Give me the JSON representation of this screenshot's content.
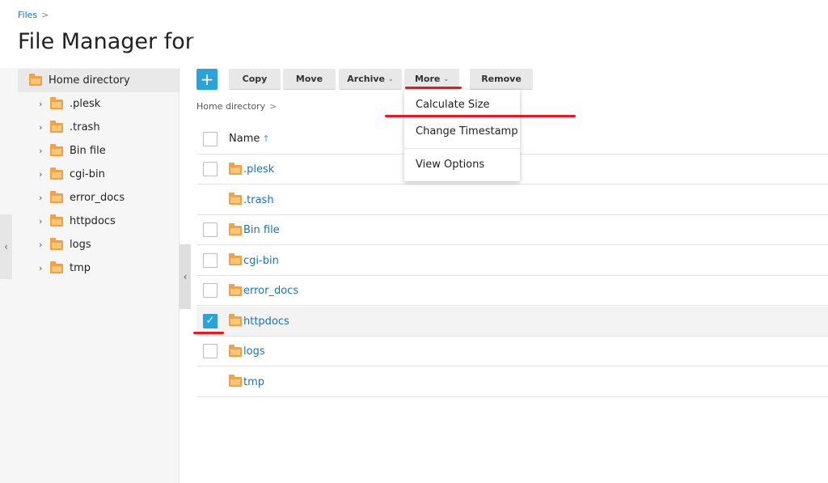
{
  "breadcrumb": {
    "label": "Files",
    "separator": ">"
  },
  "page": {
    "title": "File Manager for"
  },
  "tree": {
    "root": "Home directory",
    "items": [
      ".plesk",
      ".trash",
      "Bin file",
      "cgi-bin",
      "error_docs",
      "httpdocs",
      "logs",
      "tmp"
    ]
  },
  "toolbar": {
    "add_label": "+",
    "copy_label": "Copy",
    "move_label": "Move",
    "archive_label": "Archive",
    "more_label": "More",
    "remove_label": "Remove",
    "caret": "⌄"
  },
  "path": {
    "label": "Home directory",
    "separator": ">"
  },
  "table": {
    "name_header": "Name",
    "sort_arrow": "↑",
    "rows": [
      {
        "name": ".plesk",
        "has_checkbox": true,
        "checked": false
      },
      {
        "name": ".trash",
        "has_checkbox": false,
        "checked": false
      },
      {
        "name": "Bin file",
        "has_checkbox": true,
        "checked": false
      },
      {
        "name": "cgi-bin",
        "has_checkbox": true,
        "checked": false
      },
      {
        "name": "error_docs",
        "has_checkbox": true,
        "checked": false
      },
      {
        "name": "httpdocs",
        "has_checkbox": true,
        "checked": true
      },
      {
        "name": "logs",
        "has_checkbox": true,
        "checked": false
      },
      {
        "name": "tmp",
        "has_checkbox": false,
        "checked": false
      }
    ]
  },
  "dropdown": {
    "items": [
      "Calculate Size",
      "Change Timestamp",
      "View Options"
    ]
  },
  "icons": {
    "folder": "folder-icon",
    "collapse": "chevron-left-icon",
    "check": "✓"
  },
  "colors": {
    "accent": "#2aa3db",
    "link": "#1a73b8",
    "folder": "#f2a244",
    "annotation": "#e31b23"
  }
}
